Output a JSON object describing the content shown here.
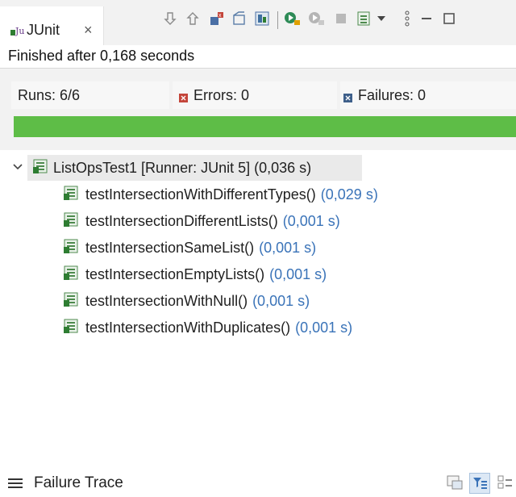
{
  "tab": {
    "title": "JUnit",
    "close": "×"
  },
  "status": "Finished after 0,168 seconds",
  "counters": {
    "runs": "Runs: 6/6",
    "errors": "Errors: 0",
    "failures": "Failures: 0"
  },
  "progress": {
    "fraction": 1.0,
    "color": "#5ebd47"
  },
  "tree": {
    "root": {
      "label": "ListOpsTest1 [Runner: JUnit 5] (0,036 s)"
    },
    "tests": [
      {
        "name": "testIntersectionWithDifferentTypes()",
        "time": "(0,029 s)"
      },
      {
        "name": "testIntersectionDifferentLists()",
        "time": "(0,001 s)"
      },
      {
        "name": "testIntersectionSameList()",
        "time": "(0,001 s)"
      },
      {
        "name": "testIntersectionEmptyLists()",
        "time": "(0,001 s)"
      },
      {
        "name": "testIntersectionWithNull()",
        "time": "(0,001 s)"
      },
      {
        "name": "testIntersectionWithDuplicates()",
        "time": "(0,001 s)"
      }
    ]
  },
  "failure_trace": {
    "label": "Failure Trace"
  },
  "toolbar_icons": [
    "next-failure-icon",
    "previous-failure-icon",
    "show-failures-only-icon",
    "scroll-lock-icon",
    "show-skipped-only-icon",
    "rerun-icon",
    "rerun-failed-first-icon",
    "stop-icon",
    "history-icon",
    "view-menu-icon",
    "more-icon",
    "minimize-icon",
    "maximize-icon"
  ],
  "colors": {
    "accent_time": "#3a73b8",
    "success": "#5ebd47",
    "error": "#c4453a"
  }
}
